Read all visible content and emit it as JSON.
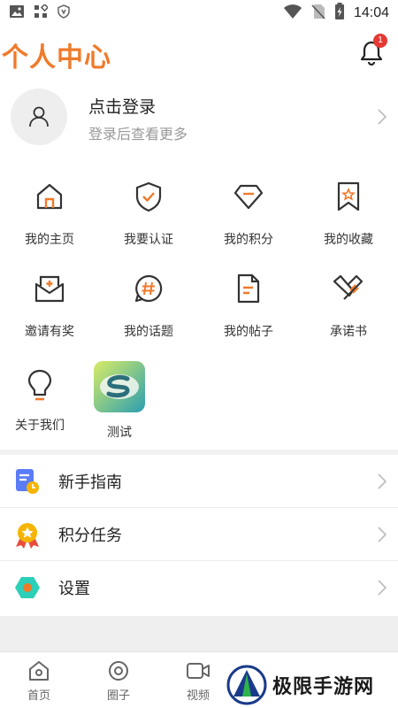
{
  "status_bar": {
    "time": "14:04"
  },
  "header": {
    "title": "个人中心",
    "notification_count": "1"
  },
  "profile": {
    "title": "点击登录",
    "subtitle": "登录后查看更多"
  },
  "grid": {
    "items": [
      {
        "label": "我的主页",
        "icon": "home-icon"
      },
      {
        "label": "我要认证",
        "icon": "shield-check-icon"
      },
      {
        "label": "我的积分",
        "icon": "diamond-icon"
      },
      {
        "label": "我的收藏",
        "icon": "bookmark-star-icon"
      },
      {
        "label": "邀请有奖",
        "icon": "envelope-invite-icon"
      },
      {
        "label": "我的话题",
        "icon": "hashtag-icon"
      },
      {
        "label": "我的帖子",
        "icon": "document-icon"
      },
      {
        "label": "承诺书",
        "icon": "handshake-icon"
      },
      {
        "label": "关于我们",
        "icon": "lightbulb-icon"
      },
      {
        "label": "测试",
        "icon": "app-logo-icon"
      }
    ]
  },
  "list": {
    "items": [
      {
        "label": "新手指南",
        "icon": "guide-icon",
        "color": "#5b7cf7"
      },
      {
        "label": "积分任务",
        "icon": "medal-icon",
        "color": "#f5b400"
      },
      {
        "label": "设置",
        "icon": "settings-hexagon-icon",
        "color": "#2ccfb8"
      }
    ]
  },
  "tabbar": {
    "items": [
      {
        "label": "首页",
        "icon": "home-tab-icon"
      },
      {
        "label": "圈子",
        "icon": "circle-tab-icon"
      },
      {
        "label": "视频",
        "icon": "video-tab-icon"
      }
    ]
  },
  "watermark": {
    "text": "极限手游网"
  },
  "colors": {
    "accent": "#f07a2a",
    "icon_stroke": "#333333",
    "badge": "#e53935"
  }
}
